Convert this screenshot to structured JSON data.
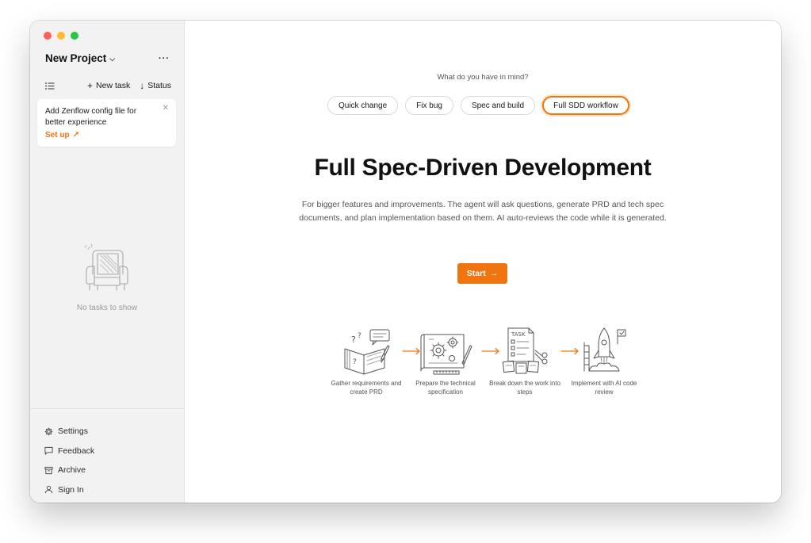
{
  "sidebar": {
    "project_title": "New Project",
    "more_label": "···",
    "new_task_label": "New task",
    "status_label": "Status",
    "notice": {
      "text": "Add Zenflow config file for better experience",
      "link": "Set up"
    },
    "empty_text": "No tasks to show",
    "menu": [
      {
        "label": "Settings",
        "icon": "gear-icon"
      },
      {
        "label": "Feedback",
        "icon": "chat-bubble-icon"
      },
      {
        "label": "Archive",
        "icon": "archive-box-icon"
      },
      {
        "label": "Sign In",
        "icon": "user-icon"
      }
    ]
  },
  "main": {
    "prompt": "What do you have in mind?",
    "modes": [
      "Quick change",
      "Fix bug",
      "Spec and build",
      "Full SDD workflow"
    ],
    "selected_mode": "Full SDD workflow",
    "headline": "Full Spec-Driven Development",
    "description": "For bigger features and improvements. The agent will ask questions, generate PRD and tech spec documents, and plan implementation based on them. AI auto-reviews the code while it is generated.",
    "start_label": "Start",
    "steps": [
      {
        "label": "Gather requirements and create PRD",
        "icon": "notebook-questions-icon"
      },
      {
        "label": "Prepare the technical specification",
        "icon": "blueprint-gears-icon"
      },
      {
        "label": "Break down the work into steps",
        "icon": "task-list-scissors-icon"
      },
      {
        "label": "Implement with AI code review",
        "icon": "rocket-launch-icon"
      }
    ]
  },
  "colors": {
    "accent": "#f07410",
    "sidebar_bg": "#f2f2f2"
  }
}
